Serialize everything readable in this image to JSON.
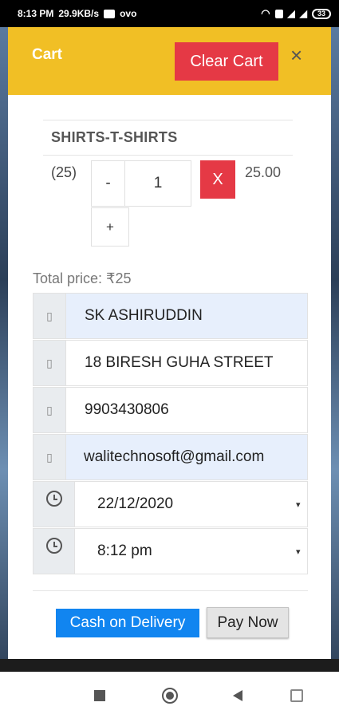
{
  "status_bar": {
    "time": "8:13 PM",
    "speed": "29.9KB/s",
    "carrier": "ovo",
    "battery": "33"
  },
  "header": {
    "title": "Cart",
    "clear_label": "Clear Cart",
    "close_glyph": "×"
  },
  "item": {
    "category": "SHIRTS-T-SHIRTS",
    "count": "(25)",
    "minus": "-",
    "quantity": "1",
    "plus": "+",
    "remove": "X",
    "price": "25.00"
  },
  "total": "Total price: ₹25",
  "fields": {
    "name": {
      "icon": "user-icon",
      "glyph": "▯",
      "value": "SK ASHIRUDDIN"
    },
    "address": {
      "icon": "home-icon",
      "glyph": "▯",
      "value": "18 BIRESH GUHA STREET"
    },
    "phone": {
      "icon": "phone-icon",
      "glyph": "▯",
      "value": "9903430806"
    },
    "email": {
      "icon": "envelope-icon",
      "glyph": "▯",
      "value": "walitechnosoft@gmail.com"
    },
    "date": {
      "icon": "clock-icon",
      "value": "22/12/2020",
      "caret": "▾"
    },
    "time": {
      "icon": "clock-icon",
      "value": "8:12 pm",
      "caret": "▾"
    }
  },
  "actions": {
    "cod_label": "Cash on Delivery",
    "pay_label": "Pay Now"
  },
  "colors": {
    "header": "#f1bf25",
    "danger": "#e53945",
    "primary": "#1185f0",
    "highlight": "#e7effc"
  }
}
